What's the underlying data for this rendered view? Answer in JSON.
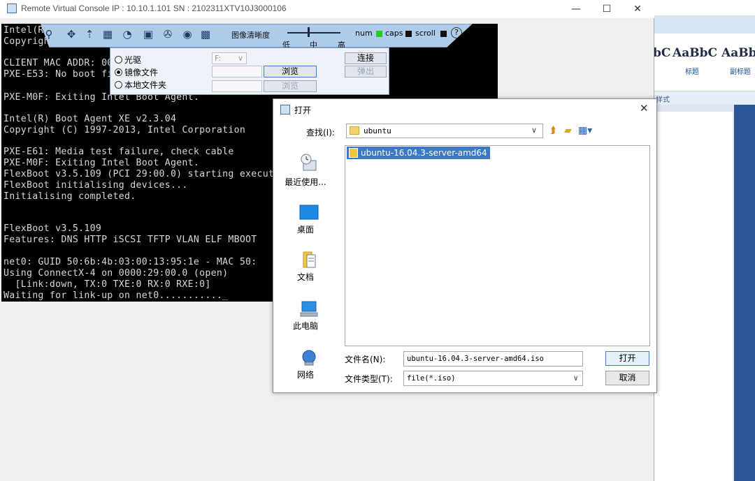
{
  "window": {
    "title": "Remote Virtual Console   IP : 10.10.1.101   SN : 2102311XTV10J3000106",
    "minimize": "—",
    "maximize": "☐",
    "close": "✕"
  },
  "terminal": {
    "lines": [
      "Intel(R) Boot Agent XE v2.3.04",
      "Copyright (C) 1997-2013, Intel Corporation",
      "",
      "CLIENT MAC ADDR: 00 1E 67 EE 0B 5F  GUID: 7E9B F898EF9D93A5",
      "PXE-E53: No boot filename received",
      "",
      "PXE-M0F: Exiting Intel Boot Agent.",
      "",
      "Intel(R) Boot Agent XE v2.3.04",
      "Copyright (C) 1997-2013, Intel Corporation",
      "",
      "PXE-E61: Media test failure, check cable",
      "PXE-M0F: Exiting Intel Boot Agent.",
      "FlexBoot v3.5.109 (PCI 29:00.0) starting execution...",
      "FlexBoot initialising devices...",
      "Initialising completed.",
      "",
      "",
      "FlexBoot v3.5.109",
      "Features: DNS HTTP iSCSI TFTP VLAN ELF MBOOT",
      "",
      "net0: GUID 50:6b:4b:03:00:13:95:1e - MAC 50:",
      "Using ConnectX-4 on 0000:29:00.0 (open)",
      "  [Link:down, TX:0 TXE:0 RX:0 RXE:0]",
      "Waiting for link-up on net0..........._"
    ]
  },
  "toolbar": {
    "clarity_label": "图像清晰度",
    "level_low": "低",
    "level_mid": "中",
    "level_high": "高",
    "quality_level": 0.4,
    "num_label": "num",
    "caps_label": "caps",
    "scroll_label": "scroll",
    "num_color": "#22cc22",
    "caps_color": "#111111",
    "scroll_color": "#111111",
    "help": "?"
  },
  "media_panel": {
    "option_cd": "光驱",
    "option_image": "镜像文件",
    "option_folder": "本地文件夹",
    "drive_value": "F:",
    "connect_label": "连接",
    "eject_label": "弹出",
    "browse_label": "浏览",
    "browse_label_disabled": "浏览"
  },
  "dialog": {
    "title": "打开",
    "close": "✕",
    "look_in_label": "查找(I):",
    "look_in_value": "ubuntu",
    "places": [
      {
        "label": "最近使用..."
      },
      {
        "label": "桌面"
      },
      {
        "label": "文档"
      },
      {
        "label": "此电脑"
      },
      {
        "label": "网络"
      }
    ],
    "files": [
      {
        "name": "ubuntu-16.04.3-server-amd64"
      }
    ],
    "filename_label": "文件名(N):",
    "filename_value": "ubuntu-16.04.3-server-amd64.iso",
    "filetype_label": "文件类型(T):",
    "filetype_value": "file(*.iso)",
    "open_button": "打开",
    "cancel_button": "取消"
  },
  "word_background": {
    "styles": [
      {
        "sample": "bC",
        "name": ""
      },
      {
        "sample": "AaBbC",
        "name": "标题"
      },
      {
        "sample": "AaBb",
        "name": "副标题"
      }
    ],
    "group_label": "样式"
  }
}
